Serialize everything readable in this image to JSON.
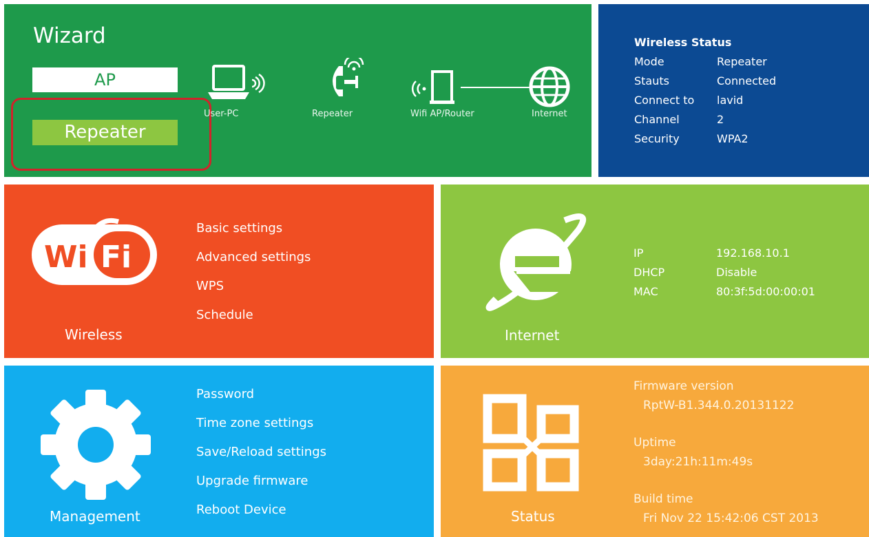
{
  "wizard": {
    "title": "Wizard",
    "modes": {
      "ap": "AP",
      "repeater": "Repeater"
    },
    "topology": {
      "user_pc": "User-PC",
      "repeater": "Repeater",
      "router": "Wifi AP/Router",
      "internet": "Internet"
    }
  },
  "wireless_status": {
    "title": "Wireless Status",
    "rows": [
      {
        "label": "Mode",
        "value": "Repeater"
      },
      {
        "label": "Stauts",
        "value": "Connected"
      },
      {
        "label": "Connect to",
        "value": "lavid"
      },
      {
        "label": "Channel",
        "value": "2"
      },
      {
        "label": "Security",
        "value": "WPA2"
      }
    ]
  },
  "wireless": {
    "caption": "Wireless",
    "logo_text": {
      "wi": "Wi",
      "fi": "Fi"
    },
    "menu": [
      "Basic settings",
      "Advanced settings",
      "WPS",
      "Schedule"
    ]
  },
  "internet": {
    "caption": "Internet",
    "rows": [
      {
        "label": "IP",
        "value": "192.168.10.1"
      },
      {
        "label": "DHCP",
        "value": "Disable"
      },
      {
        "label": "MAC",
        "value": "80:3f:5d:00:00:01"
      }
    ]
  },
  "management": {
    "caption": "Management",
    "menu": [
      "Password",
      "Time zone settings",
      "Save/Reload settings",
      "Upgrade firmware",
      "Reboot Device"
    ]
  },
  "status": {
    "caption": "Status",
    "firmware_label": "Firmware version",
    "firmware_value": "RptW-B1.344.0.20131122",
    "uptime_label": "Uptime",
    "uptime_value": "3day:21h:11m:49s",
    "build_label": "Build time",
    "build_value": "Fri Nov 22 15:42:06 CST 2013"
  },
  "colors": {
    "wizard": "#1e9a4b",
    "wireless_status": "#0c4a93",
    "wireless": "#f04e23",
    "internet": "#8dc641",
    "management": "#12adee",
    "status": "#f7a93c",
    "highlight": "#d2232a"
  }
}
